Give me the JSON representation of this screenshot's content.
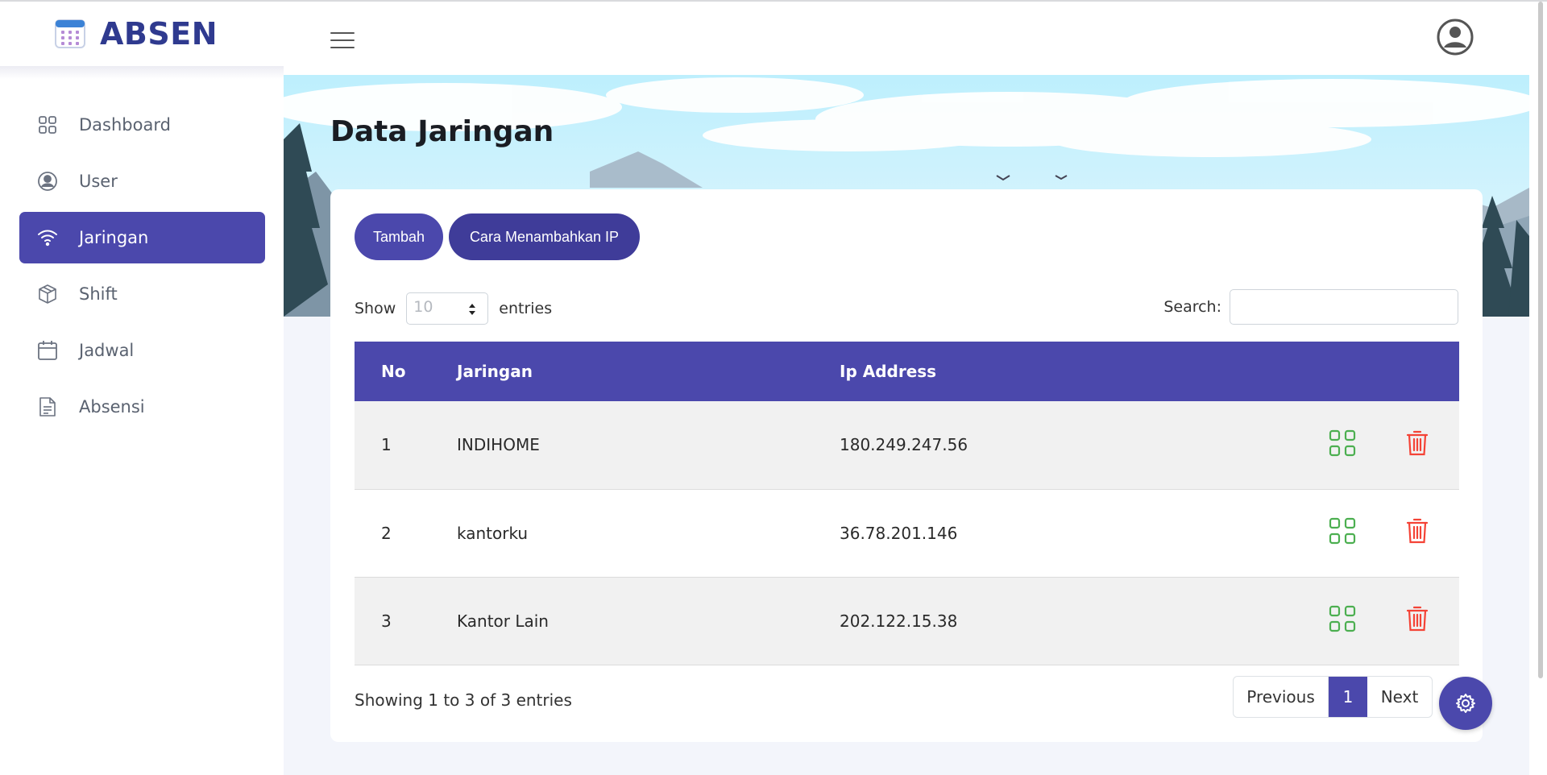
{
  "app": {
    "name": "ABSEN"
  },
  "sidebar": {
    "items": [
      {
        "label": "Dashboard",
        "icon": "grid-icon",
        "active": false
      },
      {
        "label": "User",
        "icon": "user-circle-icon",
        "active": false
      },
      {
        "label": "Jaringan",
        "icon": "wifi-icon",
        "active": true
      },
      {
        "label": "Shift",
        "icon": "box-icon",
        "active": false
      },
      {
        "label": "Jadwal",
        "icon": "calendar-icon",
        "active": false
      },
      {
        "label": "Absensi",
        "icon": "document-icon",
        "active": false
      }
    ]
  },
  "page": {
    "title": "Data Jaringan"
  },
  "toolbar": {
    "add_label": "Tambah",
    "howto_label": "Cara Menambahkan IP"
  },
  "table_controls": {
    "show_label": "Show",
    "entries_label": "entries",
    "page_size": "10",
    "search_label": "Search:",
    "search_value": ""
  },
  "table": {
    "columns": [
      "No",
      "Jaringan",
      "Ip Address"
    ],
    "rows": [
      {
        "no": "1",
        "jaringan": "INDIHOME",
        "ip": "180.249.247.56"
      },
      {
        "no": "2",
        "jaringan": "kantorku",
        "ip": "36.78.201.146"
      },
      {
        "no": "3",
        "jaringan": "Kantor Lain",
        "ip": "202.122.15.38"
      }
    ]
  },
  "footer": {
    "info": "Showing 1 to 3 of 3 entries",
    "prev_label": "Previous",
    "current_page": "1",
    "next_label": "Next"
  },
  "colors": {
    "primary": "#4b48ac",
    "brand": "#2f3a8f",
    "edit_icon": "#4caf50",
    "delete_icon": "#f44336"
  }
}
